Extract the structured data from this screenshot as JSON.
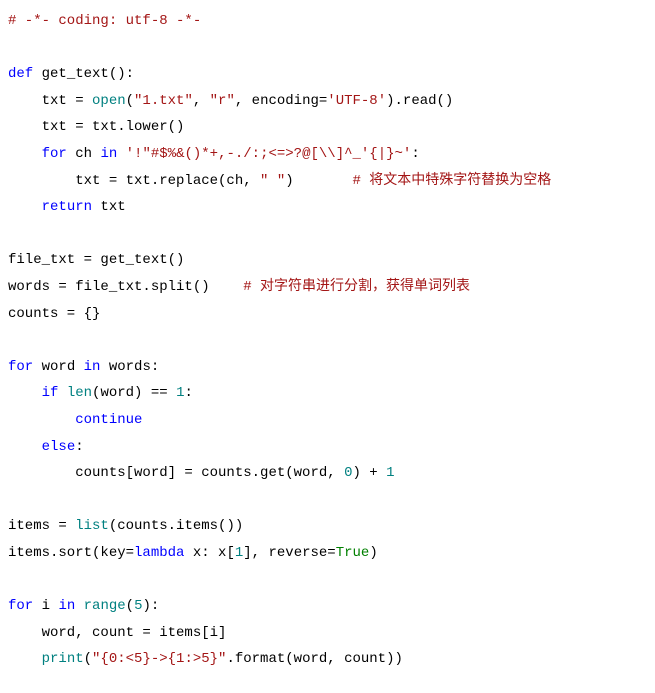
{
  "code": {
    "l1_comment": "# -*- coding: utf-8 -*-",
    "l3_def": "def",
    "l3_name": "get_text",
    "l3_rest": "():",
    "l4_a": "    txt = ",
    "l4_open": "open",
    "l4_b": "(",
    "l4_s1": "\"1.txt\"",
    "l4_c": ", ",
    "l4_s2": "\"r\"",
    "l4_d": ", encoding=",
    "l4_s3": "'UTF-8'",
    "l4_e": ").read()",
    "l5": "    txt = txt.lower()",
    "l6_a": "    ",
    "l6_for": "for",
    "l6_b": " ch ",
    "l6_in": "in",
    "l6_c": " ",
    "l6_str": "'!\"#$%&()*+,-./:;<=>?@[\\\\]^_'{|}~'",
    "l6_d": ":",
    "l7_a": "        txt = txt.replace(ch, ",
    "l7_s": "\" \"",
    "l7_b": ")       ",
    "l7_cm": "# 将文本中特殊字符替换为空格",
    "l8_a": "    ",
    "l8_ret": "return",
    "l8_b": " txt",
    "l10": "file_txt = get_text()",
    "l11_a": "words = file_txt.split()    ",
    "l11_cm": "# 对字符串进行分割，获得单词列表",
    "l12": "counts = {}",
    "l14_for": "for",
    "l14_a": " word ",
    "l14_in": "in",
    "l14_b": " words:",
    "l15_a": "    ",
    "l15_if": "if",
    "l15_b": " ",
    "l15_len": "len",
    "l15_c": "(word) == ",
    "l15_n": "1",
    "l15_d": ":",
    "l16_a": "        ",
    "l16_cont": "continue",
    "l17_a": "    ",
    "l17_else": "else",
    "l17_b": ":",
    "l18_a": "        counts[word] = counts.get(word, ",
    "l18_n": "0",
    "l18_b": ") + ",
    "l18_n2": "1",
    "l20_a": "items = ",
    "l20_list": "list",
    "l20_b": "(counts.items())",
    "l21_a": "items.sort(key=",
    "l21_lam": "lambda",
    "l21_b": " x: x[",
    "l21_n": "1",
    "l21_c": "], reverse=",
    "l21_true": "True",
    "l21_d": ")",
    "l23_for": "for",
    "l23_a": " i ",
    "l23_in": "in",
    "l23_b": " ",
    "l23_range": "range",
    "l23_c": "(",
    "l23_n": "5",
    "l23_d": "):",
    "l24": "    word, count = items[i]",
    "l25_a": "    ",
    "l25_print": "print",
    "l25_b": "(",
    "l25_s": "\"{0:<5}->{1:>5}\"",
    "l25_c": ".format(word, count))"
  }
}
